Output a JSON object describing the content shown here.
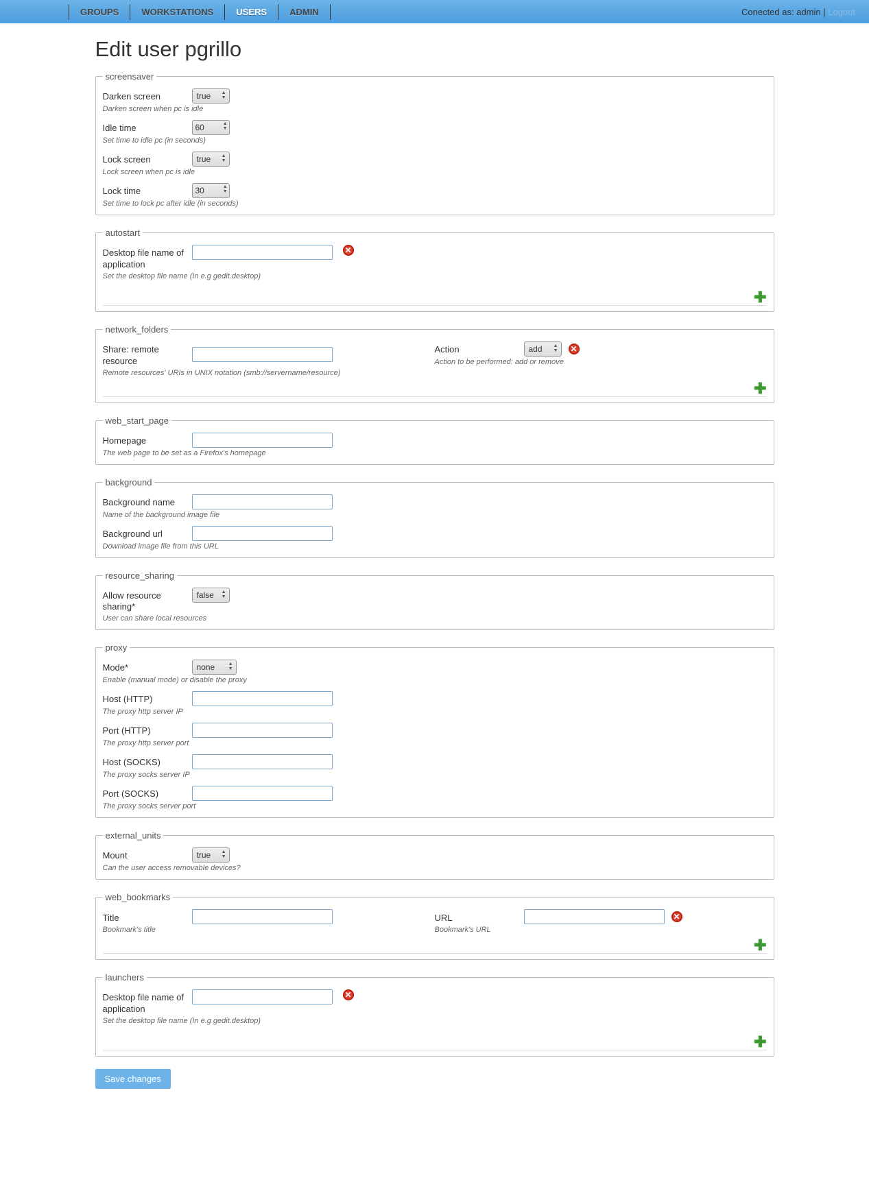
{
  "nav": {
    "items": [
      {
        "label": "GROUPS"
      },
      {
        "label": "WORKSTATIONS"
      },
      {
        "label": "USERS"
      },
      {
        "label": "ADMIN"
      }
    ],
    "connected_prefix": "Conected as: ",
    "connected_user": "admin",
    "separator": " | ",
    "logout": "Logout"
  },
  "page_title": "Edit user pgrillo",
  "screensaver": {
    "legend": "screensaver",
    "darken_label": "Darken screen",
    "darken_value": "true",
    "darken_help": "Darken screen when pc is idle",
    "idle_label": "Idle time",
    "idle_value": "60",
    "idle_help": "Set time to idle pc (in seconds)",
    "lock_label": "Lock screen",
    "lock_value": "true",
    "lock_help": "Lock screen when pc is idle",
    "locktime_label": "Lock time",
    "locktime_value": "30",
    "locktime_help": "Set time to lock pc after idle (in seconds)"
  },
  "autostart": {
    "legend": "autostart",
    "label": "Desktop file name of application",
    "value": "",
    "help": "Set the desktop file name (In e.g gedit.desktop)"
  },
  "network_folders": {
    "legend": "network_folders",
    "share_label": "Share: remote resource",
    "share_value": "",
    "share_help": "Remote resources' URIs in UNIX notation (smb://servername/resource)",
    "action_label": "Action",
    "action_value": "add",
    "action_help": "Action to be performed: add or remove"
  },
  "web_start_page": {
    "legend": "web_start_page",
    "label": "Homepage",
    "value": "",
    "help": "The web page to be set as a Firefox's homepage"
  },
  "background": {
    "legend": "background",
    "name_label": "Background name",
    "name_value": "",
    "name_help": "Name of the background image file",
    "url_label": "Background url",
    "url_value": "",
    "url_help": "Download image file from this URL"
  },
  "resource_sharing": {
    "legend": "resource_sharing",
    "label": "Allow resource sharing*",
    "value": "false",
    "help": "User can share local resources"
  },
  "proxy": {
    "legend": "proxy",
    "mode_label": "Mode*",
    "mode_value": "none",
    "mode_help": "Enable (manual mode) or disable the proxy",
    "hosthttp_label": "Host (HTTP)",
    "hosthttp_value": "",
    "hosthttp_help": "The proxy http server IP",
    "porthttp_label": "Port (HTTP)",
    "porthttp_value": "",
    "porthttp_help": "The proxy http server port",
    "hostsocks_label": "Host (SOCKS)",
    "hostsocks_value": "",
    "hostsocks_help": "The proxy socks server IP",
    "portsocks_label": "Port (SOCKS)",
    "portsocks_value": "",
    "portsocks_help": "The proxy socks server port"
  },
  "external_units": {
    "legend": "external_units",
    "label": "Mount",
    "value": "true",
    "help": "Can the user access removable devices?"
  },
  "web_bookmarks": {
    "legend": "web_bookmarks",
    "title_label": "Title",
    "title_value": "",
    "title_help": "Bookmark's title",
    "url_label": "URL",
    "url_value": "",
    "url_help": "Bookmark's URL"
  },
  "launchers": {
    "legend": "launchers",
    "label": "Desktop file name of application",
    "value": "",
    "help": "Set the desktop file name (In e.g gedit.desktop)"
  },
  "save_button": "Save changes"
}
